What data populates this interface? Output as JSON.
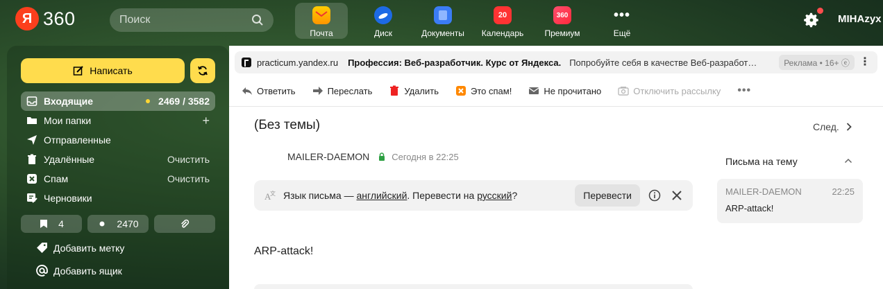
{
  "header": {
    "logo_letter": "Я",
    "logo_text": "360",
    "search_placeholder": "Поиск",
    "services": [
      {
        "label": "Почта",
        "icon": "mail-icon",
        "active": true
      },
      {
        "label": "Диск",
        "icon": "disk-icon"
      },
      {
        "label": "Документы",
        "icon": "docs-icon"
      },
      {
        "label": "Календарь",
        "icon": "calendar-icon",
        "badge": "20"
      },
      {
        "label": "Премиум",
        "icon": "premium-icon",
        "badge": "360"
      },
      {
        "label": "Ещё",
        "icon": "more-icon",
        "glyph": "•••"
      }
    ],
    "user": "MIHAzyx"
  },
  "sidebar": {
    "compose_label": "Написать",
    "folders": [
      {
        "name": "Входящие",
        "right": "2469 / 3582",
        "icon": "inbox-icon",
        "active": true
      },
      {
        "name": "Мои папки",
        "right": "+",
        "icon": "folders-icon"
      },
      {
        "name": "Отправленные",
        "right": "",
        "icon": "sent-icon"
      },
      {
        "name": "Удалённые",
        "right": "Очистить",
        "icon": "trash-icon"
      },
      {
        "name": "Спам",
        "right": "Очистить",
        "icon": "spam-icon"
      },
      {
        "name": "Черновики",
        "right": "",
        "icon": "drafts-icon"
      }
    ],
    "pills": {
      "bookmarks": "4",
      "unread": "2470"
    },
    "add_label": "Добавить метку",
    "add_mailbox": "Добавить ящик"
  },
  "ad": {
    "site": "practicum.yandex.ru",
    "title": "Профессия: Веб-разработчик. Курс от Яндекса.",
    "text": "Попробуйте себя в качестве Веб-разработчика",
    "badge": "Реклама • 16+ ⓔ",
    "more": "⋮"
  },
  "toolbar": {
    "reply": "Ответить",
    "forward": "Переслать",
    "delete": "Удалить",
    "spam": "Это спам!",
    "unread": "Не прочитано",
    "unsubscribe": "Отключить рассылку",
    "more": "•••"
  },
  "message": {
    "subject": "(Без темы)",
    "next_label": "След.",
    "sender": "MAILER-DAEMON",
    "date": "Сегодня в 22:25",
    "translate": {
      "prefix": "Язык письма — ",
      "lang_from": "английский",
      "middle": ". Перевести на ",
      "lang_to": "русский",
      "suffix": "?",
      "button": "Перевести"
    },
    "body": "ARP-attack!"
  },
  "thread": {
    "title": "Письма на тему",
    "items": [
      {
        "from": "MAILER-DAEMON",
        "time": "22:25",
        "subject": "ARP-attack!"
      }
    ]
  },
  "colors": {
    "accent_yellow": "#ffdc4d",
    "logo_red": "#fc3f1d",
    "calendar_red": "#f33",
    "secure_green": "#2ea043"
  }
}
